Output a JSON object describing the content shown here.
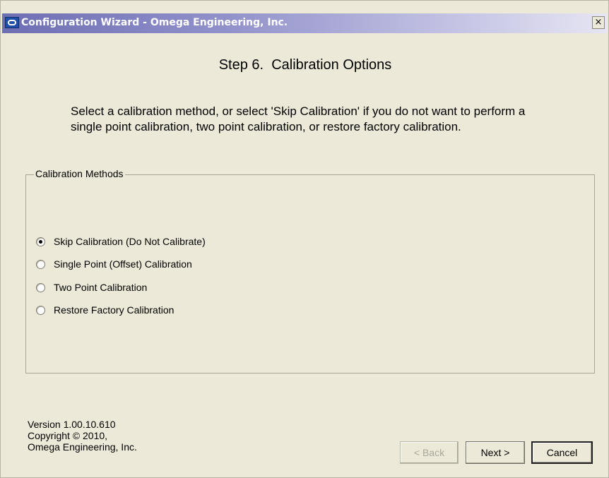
{
  "window": {
    "title": "Configuration Wizard - Omega Engineering, Inc.",
    "close_label": "×"
  },
  "step": {
    "title": "Step 6.  Calibration Options",
    "description": "Select a calibration method, or select 'Skip Calibration' if you do not want to perform a single point calibration, two point calibration, or restore factory calibration."
  },
  "group": {
    "legend": "Calibration Methods",
    "options": [
      {
        "label": "Skip Calibration (Do Not Calibrate)",
        "selected": true
      },
      {
        "label": "Single Point (Offset) Calibration",
        "selected": false
      },
      {
        "label": "Two Point Calibration",
        "selected": false
      },
      {
        "label": "Restore Factory Calibration",
        "selected": false
      }
    ]
  },
  "footer": {
    "version": "Version 1.00.10.610",
    "copyright": "Copyright © 2010,",
    "company": "Omega Engineering, Inc."
  },
  "buttons": {
    "back": "< Back",
    "next": "Next >",
    "cancel": "Cancel"
  },
  "colors": {
    "title_gradient_start": "#6d6fb3",
    "title_gradient_end": "#e6e5f3",
    "dialog_bg": "#ece9d8"
  }
}
